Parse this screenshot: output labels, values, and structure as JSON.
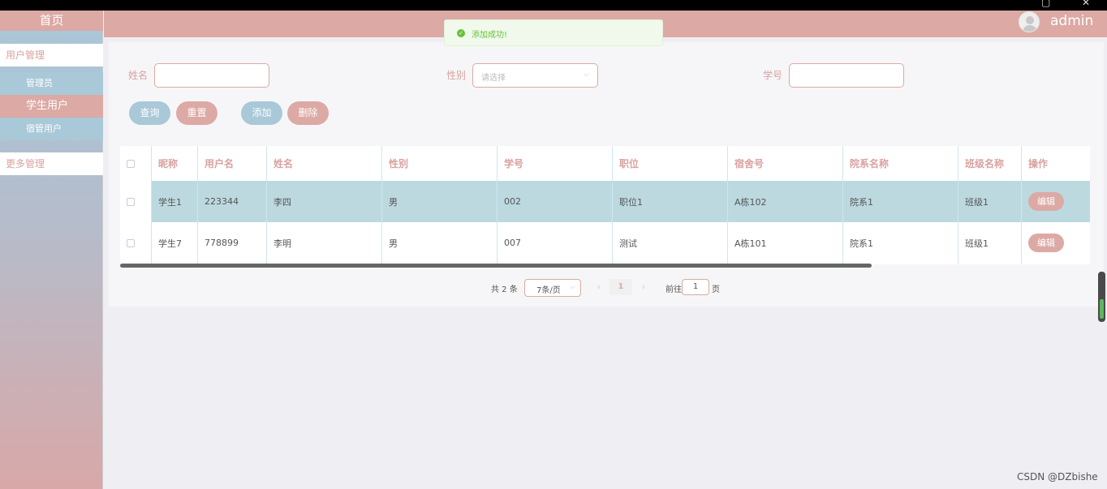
{
  "window": {
    "maximize_icon": "maximize-icon",
    "close_icon": "close-icon"
  },
  "sidebar": {
    "home": "首页",
    "user_group": "用户管理",
    "items": [
      {
        "label": "管理员"
      },
      {
        "label": "学生用户"
      },
      {
        "label": "宿管用户"
      }
    ],
    "more_group": "更多管理"
  },
  "header": {
    "username": "admin",
    "avatar_icon": "user-avatar-icon"
  },
  "toast": {
    "message": "添加成功!",
    "icon": "check-circle-icon",
    "color": "#67c23a"
  },
  "search": {
    "name_label": "姓名",
    "gender_label": "性别",
    "gender_placeholder": "请选择",
    "student_no_label": "学号"
  },
  "buttons": {
    "query": "查询",
    "reset": "重置",
    "add": "添加",
    "delete": "删除"
  },
  "table": {
    "columns": [
      "昵称",
      "用户名",
      "姓名",
      "性别",
      "学号",
      "职位",
      "宿舍号",
      "院系名称",
      "班级名称",
      "操作"
    ],
    "rows": [
      [
        "学生1",
        "223344",
        "李四",
        "男",
        "002",
        "职位1",
        "A栋102",
        "院系1",
        "班级1"
      ],
      [
        "学生7",
        "778899",
        "李明",
        "男",
        "007",
        "测试",
        "A栋101",
        "院系1",
        "班级1"
      ]
    ],
    "edit_label": "编辑"
  },
  "pagination": {
    "total": "共 2 条",
    "page_size": "7条/页",
    "current_page": "1",
    "goto_label": "前往",
    "goto_value": "1",
    "page_suffix": "页"
  },
  "watermark": "CSDN @DZbishe",
  "colors": {
    "accent_pink": "#dca9a4",
    "accent_blue": "#a9c8d8",
    "row_highlight": "#bcd9e0"
  }
}
